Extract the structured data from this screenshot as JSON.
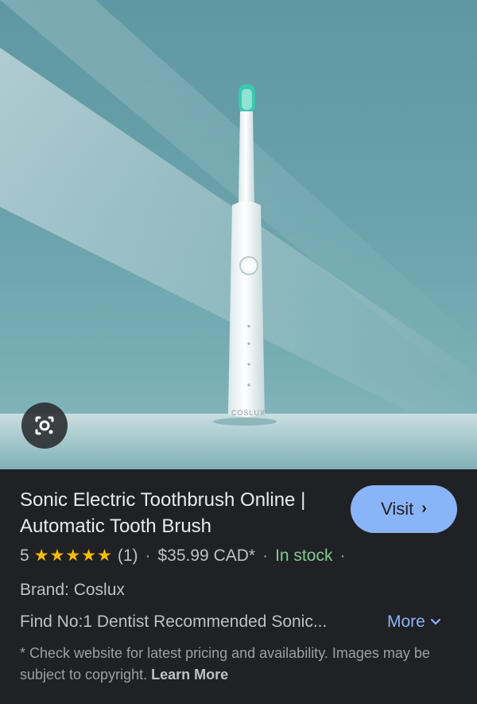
{
  "product": {
    "title": "Sonic Electric Toothbrush Online | Automatic Tooth Brush",
    "brand_logo_text": "COSLUX",
    "image_alt": "White sonic electric toothbrush standing on a blue background"
  },
  "visit_button": {
    "label": "Visit"
  },
  "meta": {
    "rating": "5",
    "stars": "★★★★★",
    "rating_value": 5,
    "review_count": "(1)",
    "separator": "·",
    "price": "$35.99 CAD*",
    "stock": "In stock",
    "stock_trailing": "·"
  },
  "brand_line": "Brand: Coslux",
  "description": "Find No:1 Dentist Recommended Sonic...",
  "more_link": {
    "label": "More"
  },
  "disclaimer": {
    "text": "* Check website for latest pricing and availability. Images may be subject to copyright.",
    "learn_more": "Learn More"
  },
  "icons": {
    "lens": "google-lens-icon",
    "visit_chevron": "chevron-right-icon",
    "more_chevron": "chevron-down-icon"
  },
  "colors": {
    "panel_bg": "#202124",
    "accent_blue": "#8ab4f8",
    "star_yellow": "#fbbc04",
    "stock_green": "#81c995"
  }
}
